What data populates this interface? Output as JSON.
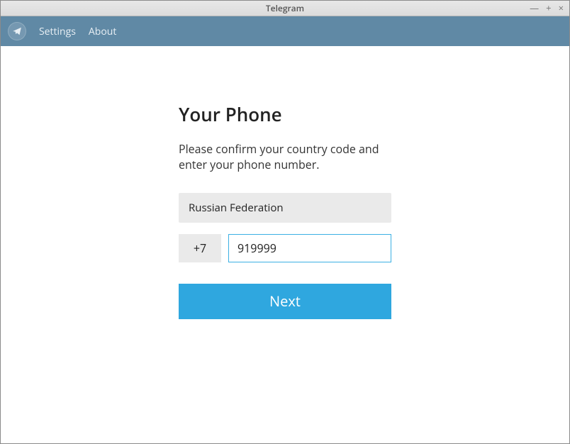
{
  "window": {
    "title": "Telegram"
  },
  "menubar": {
    "settings": "Settings",
    "about": "About"
  },
  "page": {
    "heading": "Your Phone",
    "instruction": "Please confirm your country code and enter your phone number.",
    "country": "Russian Federation",
    "country_code": "+7",
    "phone_number": "919999",
    "next_label": "Next"
  }
}
